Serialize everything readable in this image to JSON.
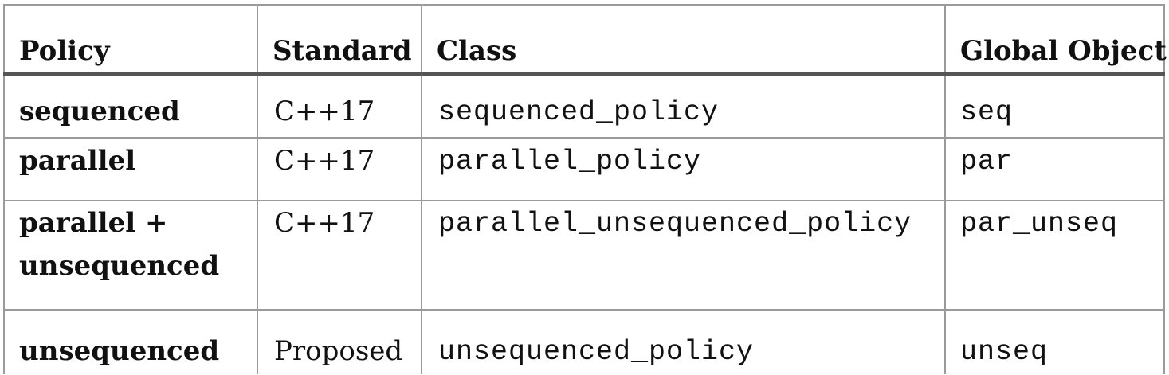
{
  "table": {
    "headers": {
      "policy": "Policy",
      "standard": "Standard",
      "class": "Class",
      "global_object": "Global Object"
    },
    "rows": [
      {
        "policy": "sequenced",
        "standard": "C++17",
        "class": "sequenced_policy",
        "global_object": "seq"
      },
      {
        "policy": "parallel",
        "standard": "C++17",
        "class": "parallel_policy",
        "global_object": "par"
      },
      {
        "policy": "parallel + unsequenced",
        "standard": "C++17",
        "class": "parallel_unsequenced_policy",
        "global_object": "par_unseq"
      },
      {
        "policy": "unsequenced",
        "standard": "Proposed",
        "class": "unsequenced_policy",
        "global_object": "unseq"
      }
    ]
  }
}
